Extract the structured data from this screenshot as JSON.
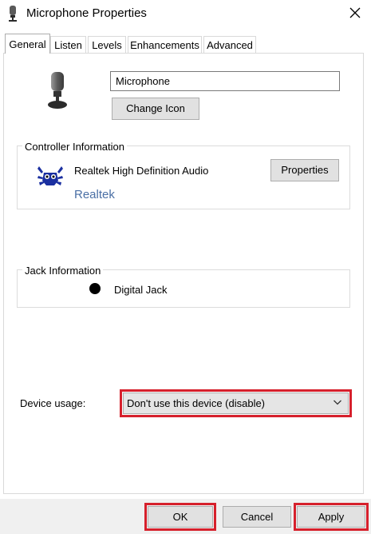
{
  "window": {
    "title": "Microphone Properties",
    "icons": {
      "title": "microphone-icon",
      "close": "close-icon"
    }
  },
  "tabs": [
    {
      "label": "General",
      "active": true
    },
    {
      "label": "Listen",
      "active": false
    },
    {
      "label": "Levels",
      "active": false
    },
    {
      "label": "Enhancements",
      "active": false
    },
    {
      "label": "Advanced",
      "active": false
    }
  ],
  "general": {
    "device_icon": "microphone-icon",
    "device_name": "Microphone",
    "change_icon_label": "Change Icon"
  },
  "controller": {
    "legend": "Controller Information",
    "icon": "realtek-crab-icon",
    "name": "Realtek High Definition Audio",
    "vendor": "Realtek",
    "properties_label": "Properties"
  },
  "jack": {
    "legend": "Jack Information",
    "name": "Digital Jack",
    "color": "#000000"
  },
  "device_usage": {
    "label": "Device usage:",
    "selected": "Don't use this device (disable)",
    "highlight_color": "#d6202c"
  },
  "buttons": {
    "ok": "OK",
    "cancel": "Cancel",
    "apply": "Apply"
  },
  "colors": {
    "highlight": "#d6202c",
    "vendor_link": "#4a6fa5",
    "button_face": "#e1e1e1"
  }
}
